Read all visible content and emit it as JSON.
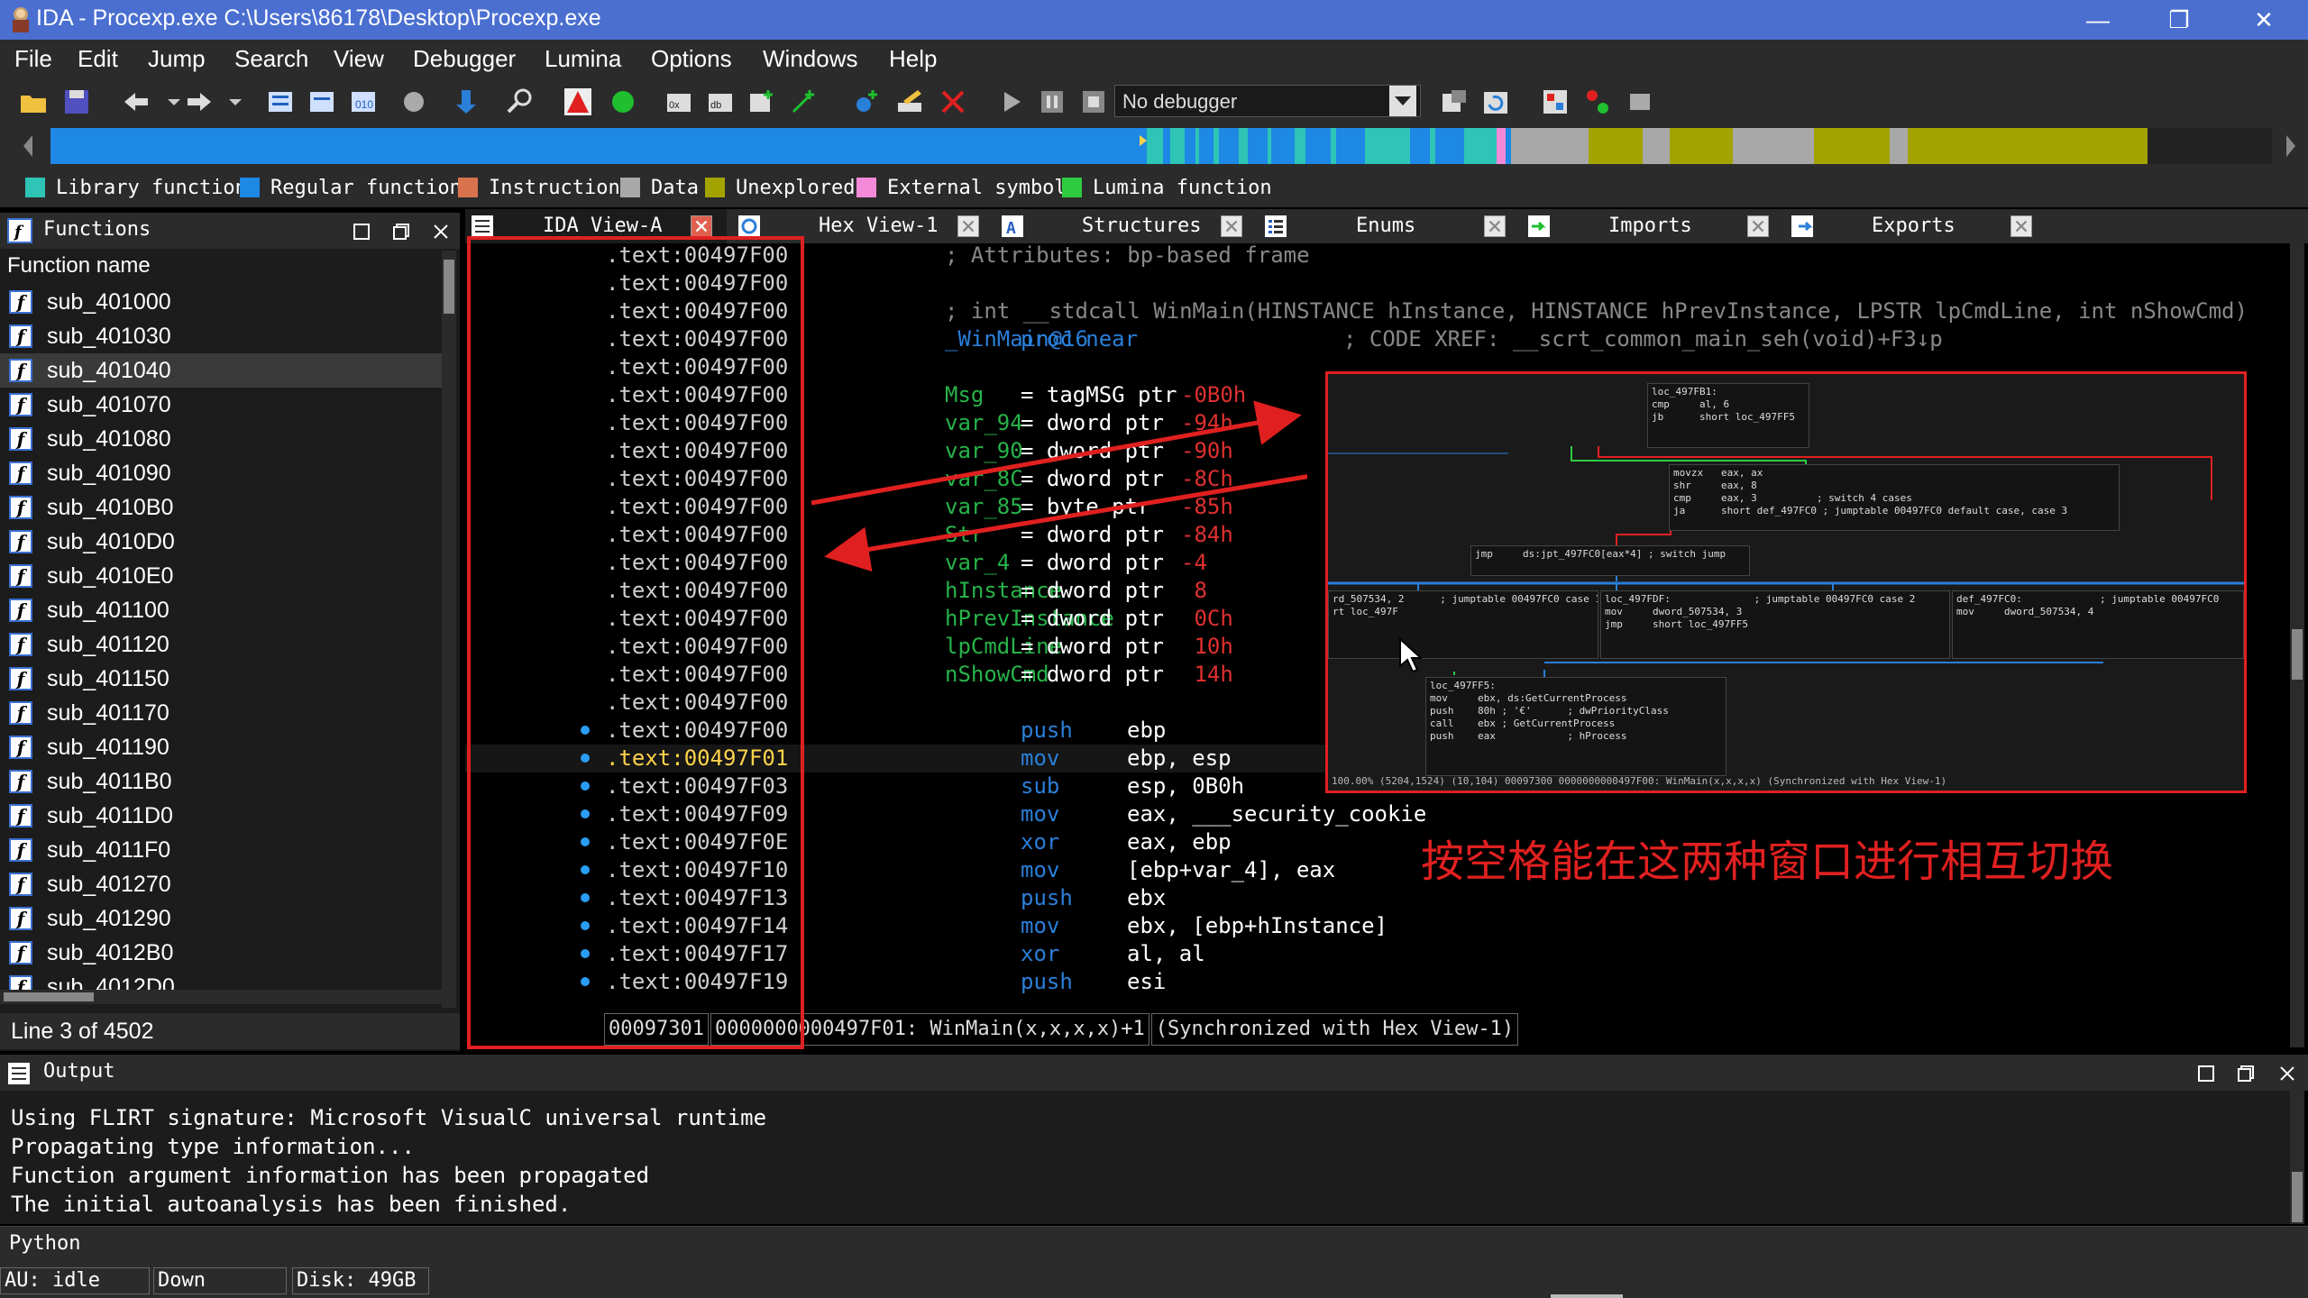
{
  "window": {
    "title": "IDA - Procexp.exe C:\\Users\\86178\\Desktop\\Procexp.exe",
    "minimize": "—",
    "restore": "❐",
    "close": "✕"
  },
  "menu": [
    "File",
    "Edit",
    "Jump",
    "Search",
    "View",
    "Debugger",
    "Lumina",
    "Options",
    "Windows",
    "Help"
  ],
  "toolbar": {
    "debugger_select": "No debugger"
  },
  "legend": [
    {
      "label": "Library function",
      "color": "#2ec4b6"
    },
    {
      "label": "Regular function",
      "color": "#1e88e5"
    },
    {
      "label": "Instruction",
      "color": "#d9734e"
    },
    {
      "label": "Data",
      "color": "#a8a8a8"
    },
    {
      "label": "Unexplored",
      "color": "#a3a300"
    },
    {
      "label": "External symbol",
      "color": "#f28ad8"
    },
    {
      "label": "Lumina function",
      "color": "#2ecc40"
    }
  ],
  "functions_panel": {
    "title": "Functions",
    "column": "Function name",
    "items": [
      "sub_401000",
      "sub_401030",
      "sub_401040",
      "sub_401070",
      "sub_401080",
      "sub_401090",
      "sub_4010B0",
      "sub_4010D0",
      "sub_4010E0",
      "sub_401100",
      "sub_401120",
      "sub_401150",
      "sub_401170",
      "sub_401190",
      "sub_4011B0",
      "sub_4011D0",
      "sub_4011F0",
      "sub_401270",
      "sub_401290",
      "sub_4012B0",
      "sub_4012D0"
    ],
    "selected_index": 2,
    "status": "Line 3 of 4502"
  },
  "tabs": [
    {
      "label": "IDA View-A"
    },
    {
      "label": "Hex View-1"
    },
    {
      "label": "Structures"
    },
    {
      "label": "Enums"
    },
    {
      "label": "Imports"
    },
    {
      "label": "Exports"
    }
  ],
  "disasm": {
    "lines": [
      {
        "addr": ".text:00497F00",
        "comment": "; Attributes: bp-based frame"
      },
      {
        "addr": ".text:00497F00"
      },
      {
        "addr": ".text:00497F00",
        "comment": "; int __stdcall WinMain(HINSTANCE hInstance, HINSTANCE hPrevInstance, LPSTR lpCmdLine, int nShowCmd)"
      },
      {
        "addr": ".text:00497F00",
        "label": "_WinMain@16",
        "mnem": "proc near",
        "comment2": "; CODE XREF: __scrt_common_main_seh(void)+F3↓p"
      },
      {
        "addr": ".text:00497F00"
      },
      {
        "addr": ".text:00497F00",
        "var": "Msg",
        "eq": "= tagMSG ptr",
        "off": "-0B0h"
      },
      {
        "addr": ".text:00497F00",
        "var": "var_94",
        "eq": "= dword ptr",
        "off": "-94h"
      },
      {
        "addr": ".text:00497F00",
        "var": "var_90",
        "eq": "= dword ptr",
        "off": "-90h"
      },
      {
        "addr": ".text:00497F00",
        "var": "var_8C",
        "eq": "= dword ptr",
        "off": "-8Ch"
      },
      {
        "addr": ".text:00497F00",
        "var": "var_85",
        "eq": "= byte ptr",
        "off": "-85h"
      },
      {
        "addr": ".text:00497F00",
        "var": "Str",
        "eq": "= dword ptr",
        "off": "-84h"
      },
      {
        "addr": ".text:00497F00",
        "var": "var_4",
        "eq": "= dword ptr",
        "off": "-4"
      },
      {
        "addr": ".text:00497F00",
        "var": "hInstance",
        "eq": "= dword ptr",
        "off": " 8"
      },
      {
        "addr": ".text:00497F00",
        "var": "hPrevInstance",
        "eq": "= dword ptr",
        "off": " 0Ch"
      },
      {
        "addr": ".text:00497F00",
        "var": "lpCmdLine",
        "eq": "= dword ptr",
        "off": " 10h"
      },
      {
        "addr": ".text:00497F00",
        "var": "nShowCmd",
        "eq": "= dword ptr",
        "off": " 14h"
      },
      {
        "addr": ".text:00497F00"
      },
      {
        "addr": ".text:00497F00",
        "mnem2": "push",
        "ops": "ebp"
      },
      {
        "addr": ".text:00497F01",
        "mnem2": "mov",
        "ops": "ebp, esp",
        "current": true
      },
      {
        "addr": ".text:00497F03",
        "mnem2": "sub",
        "ops": "esp, 0B0h"
      },
      {
        "addr": ".text:00497F09",
        "mnem2": "mov",
        "ops": "eax, ___security_cookie"
      },
      {
        "addr": ".text:00497F0E",
        "mnem2": "xor",
        "ops": "eax, ebp"
      },
      {
        "addr": ".text:00497F10",
        "mnem2": "mov",
        "ops": "[ebp+var_4], eax"
      },
      {
        "addr": ".text:00497F13",
        "mnem2": "push",
        "ops": "ebx"
      },
      {
        "addr": ".text:00497F14",
        "mnem2": "mov",
        "ops": "ebx, [ebp+hInstance]"
      },
      {
        "addr": ".text:00497F17",
        "mnem2": "xor",
        "ops": "al, al"
      },
      {
        "addr": ".text:00497F19",
        "mnem2": "push",
        "ops": "esi"
      }
    ],
    "status": [
      "00097301",
      "0000000000497F01: WinMain(x,x,x,x)+1",
      "(Synchronized with Hex View-1)"
    ]
  },
  "graph": {
    "nodes": [
      {
        "text": "loc_497FB1:\ncmp     al, 6\njb      short loc_497FF5"
      },
      {
        "text": "movzx   eax, ax\nshr     eax, 8\ncmp     eax, 3          ; switch 4 cases\nja      short def_497FC0 ; jumptable 00497FC0 default case, case 3"
      },
      {
        "text": "jmp     ds:jpt_497FC0[eax*4] ; switch jump"
      },
      {
        "text": "rd_507534, 2      ; jumptable 00497FC0 case 1\nrt loc_497F"
      },
      {
        "text": "loc_497FDF:              ; jumptable 00497FC0 case 2\nmov     dword_507534, 3\njmp     short loc_497FF5"
      },
      {
        "text": "def_497FC0:             ; jumptable 00497FC0\nmov     dword_507534, 4"
      },
      {
        "text": "loc_497FF5:\nmov     ebx, ds:GetCurrentProcess\npush    80h ; '€'      ; dwPriorityClass\ncall    ebx ; GetCurrentProcess\npush    eax            ; hProcess"
      }
    ],
    "status": "100.00% (5204,1524) (10,104) 00097300 0000000000497F00: WinMain(x,x,x,x) (Synchronized with Hex View-1)"
  },
  "annotation": "按空格能在这两种窗口进行相互切换",
  "output": {
    "title": "Output",
    "lines": [
      "Using FLIRT signature: Microsoft VisualC universal runtime",
      "Propagating type information...",
      "Function argument information has been propagated",
      "The initial autoanalysis has been finished."
    ]
  },
  "python_label": "Python",
  "statusbar": {
    "au": "AU:  idle",
    "direction": "Down",
    "disk": "Disk: 49GB"
  }
}
